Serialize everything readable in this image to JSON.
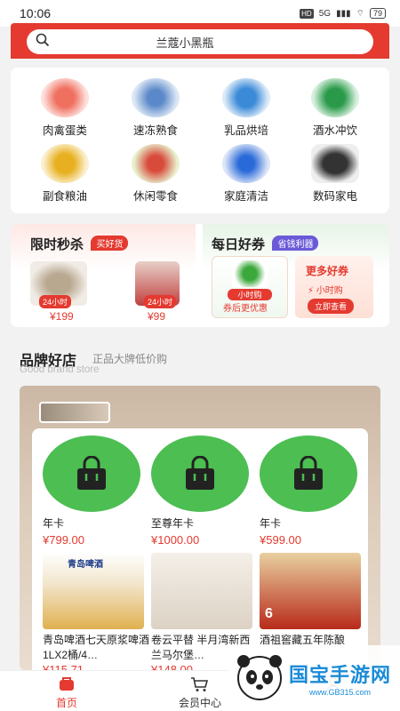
{
  "status": {
    "time": "10:06",
    "hd": "HD",
    "signal": "5G",
    "battery": "79"
  },
  "search": {
    "placeholder": "兰蔻小黑瓶"
  },
  "categories": [
    {
      "label": "肉禽蛋类",
      "icon": "meat-icon",
      "color": "#e85a4a"
    },
    {
      "label": "速冻熟食",
      "icon": "frozen-food-icon",
      "color": "#7aa8d8"
    },
    {
      "label": "乳品烘培",
      "icon": "milk-icon",
      "color": "#4a9ad8"
    },
    {
      "label": "酒水冲饮",
      "icon": "drink-icon",
      "color": "#3aa85a"
    },
    {
      "label": "副食粮油",
      "icon": "oil-icon",
      "color": "#e8b830"
    },
    {
      "label": "休闲零食",
      "icon": "snack-icon",
      "color": "#d84a3a"
    },
    {
      "label": "家庭清洁",
      "icon": "detergent-icon",
      "color": "#3a7ad8"
    },
    {
      "label": "数码家电",
      "icon": "appliance-icon",
      "color": "#444444"
    }
  ],
  "promo": {
    "flash": {
      "title": "限时秒杀",
      "tag": "买好货",
      "items": [
        {
          "badge": "24小时",
          "price": "¥199"
        },
        {
          "badge": "24小时",
          "price": "¥99"
        }
      ]
    },
    "coupon": {
      "title": "每日好券",
      "tag": "省钱利器",
      "left": {
        "badge": "小时购",
        "button": "券后更优惠"
      },
      "right": {
        "title": "更多好券",
        "badge": "小时购",
        "button": "立即查看"
      }
    }
  },
  "brand": {
    "title": "品牌好店",
    "subtitle": "正品大牌低价购",
    "en": "Good brand store"
  },
  "cards": [
    {
      "name": "年卡",
      "price": "¥799.00"
    },
    {
      "name": "至尊年卡",
      "price": "¥1000.00"
    },
    {
      "name": "年卡",
      "price": "¥599.00"
    }
  ],
  "products": [
    {
      "name": "青岛啤酒七天原浆啤酒1LX2桶/4…",
      "price": "¥115.71",
      "img_label": "青岛啤酒"
    },
    {
      "name": "卷云平替 半月湾新西兰马尔堡…",
      "price": "¥148.00",
      "img_label": ""
    },
    {
      "name": "酒祖窖藏五年陈酿",
      "price": "",
      "img_label": "6"
    }
  ],
  "tabs": [
    {
      "label": "首页",
      "icon": "home-cart-icon"
    },
    {
      "label": "会员中心",
      "icon": "cart-icon"
    },
    {
      "label": "",
      "icon": "user-icon"
    }
  ],
  "watermark": {
    "brand": "国宝手游网",
    "url": "www.GB315.com"
  },
  "colors": {
    "accent": "#e43a30",
    "green": "#4cbe52"
  }
}
